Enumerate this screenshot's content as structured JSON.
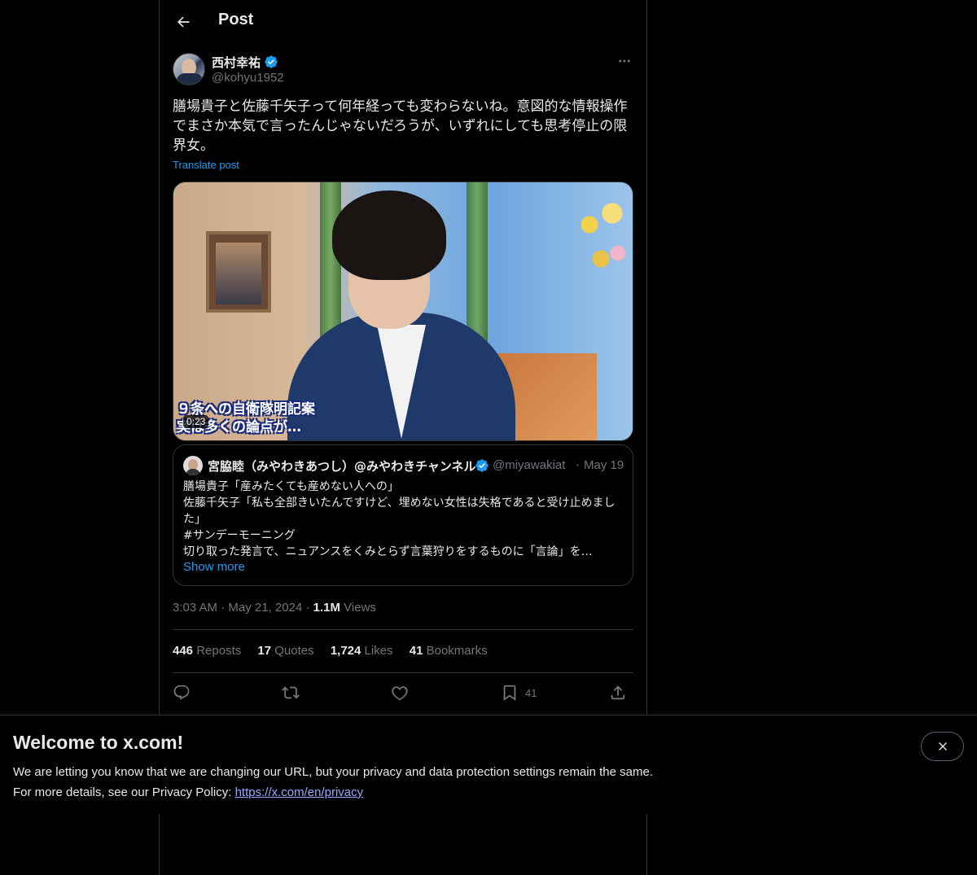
{
  "header": {
    "title": "Post"
  },
  "post": {
    "author_name": "西村幸祐",
    "author_handle": "@kohyu1952",
    "text": "膳場貴子と佐藤千矢子って何年経っても変わらないね。意図的な情報操作\nでまさか本気で言ったんじゃないだろうが、いずれにしても思考停止の限\n界女。",
    "translate_label": "Translate post",
    "media": {
      "caption": "９条への自衛隊明記案\n実は多くの論点が…",
      "duration": "0:23"
    },
    "quoted": {
      "author_name": "宮脇睦（みやわきあつし）@みやわきチャンネル",
      "author_handle": "@miyawakiat",
      "separator": "·",
      "date": "May 19",
      "lines": [
        "膳場貴子「産みたくても産めない人への」",
        "佐藤千矢子「私も全部きいたんですけど、埋めない女性は失格であると受け止めました」",
        "#サンデーモーニング",
        "切り取った発言で、ニュアンスをくみとらず言葉狩りをするものに「言論」を…"
      ],
      "show_more": "Show more"
    },
    "time": "3:03 AM",
    "dot": "·",
    "date": "May 21, 2024",
    "views_count": "1.1M",
    "views_label": "Views",
    "stats": [
      {
        "count": "446",
        "label": "Reposts"
      },
      {
        "count": "17",
        "label": "Quotes"
      },
      {
        "count": "1,724",
        "label": "Likes"
      },
      {
        "count": "41",
        "label": "Bookmarks"
      }
    ],
    "bookmark_count": "41"
  },
  "banner": {
    "title": "Welcome to x.com!",
    "line1": "We are letting you know that we are changing our URL, but your privacy and data protection settings remain the same.",
    "line2_prefix": "For more details, see our Privacy Policy: ",
    "link": "https://x.com/en/privacy"
  },
  "icons": {
    "back": "arrow-left-icon",
    "verified": "verified-badge-icon",
    "more": "more-horizontal-icon",
    "reply": "reply-icon",
    "repost": "repost-icon",
    "like": "heart-icon",
    "bookmark": "bookmark-icon",
    "share": "share-icon",
    "close": "close-icon"
  },
  "colors": {
    "accent": "#1d9bf0",
    "background": "#000000",
    "text": "#e7e9ea",
    "muted": "#71767b",
    "border": "#2f3336"
  }
}
